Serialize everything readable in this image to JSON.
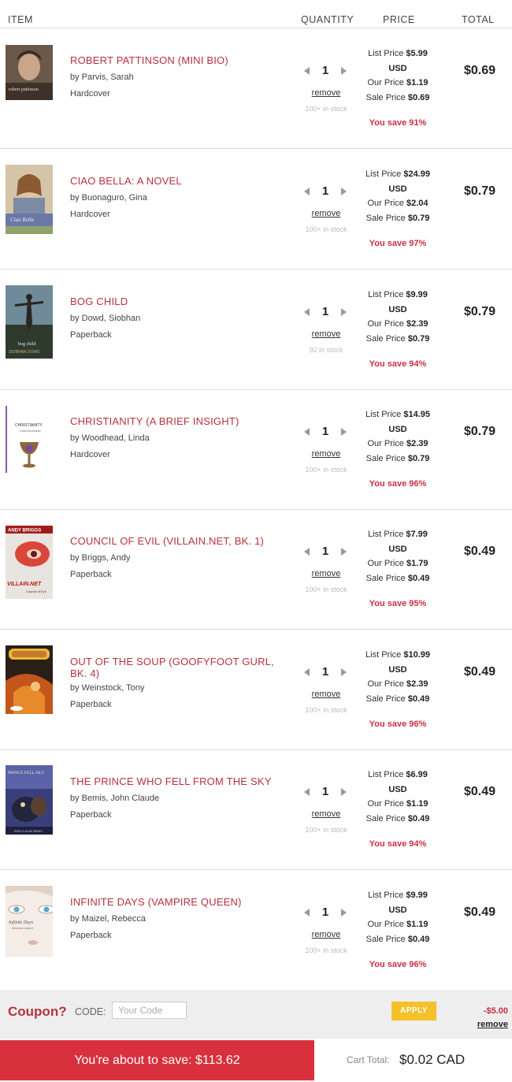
{
  "header": {
    "item": "ITEM",
    "quantity": "QUANTITY",
    "price": "PRICE",
    "total": "TOTAL"
  },
  "items": [
    {
      "title": "ROBERT PATTINSON (MINI BIO)",
      "author": "by Parvis, Sarah",
      "format": "Hardcover",
      "quantity": "1",
      "remove": "remove",
      "stock": "100+ in stock",
      "list_price": "$5.99",
      "currency": "USD",
      "our_price": "$1.19",
      "sale_price": "$0.69",
      "you_save": "You save 91%",
      "total": "$0.69"
    },
    {
      "title": "CIAO BELLA: A NOVEL",
      "author": "by Buonaguro, Gina",
      "format": "Hardcover",
      "quantity": "1",
      "remove": "remove",
      "stock": "100+ in stock",
      "list_price": "$24.99",
      "currency": "USD",
      "our_price": "$2.04",
      "sale_price": "$0.79",
      "you_save": "You save 97%",
      "total": "$0.79"
    },
    {
      "title": "BOG CHILD",
      "author": "by Dowd, Siobhan",
      "format": "Paperback",
      "quantity": "1",
      "remove": "remove",
      "stock": "92 in stock",
      "list_price": "$9.99",
      "currency": "USD",
      "our_price": "$2.39",
      "sale_price": "$0.79",
      "you_save": "You save 94%",
      "total": "$0.79"
    },
    {
      "title": "CHRISTIANITY (A BRIEF INSIGHT)",
      "author": "by Woodhead, Linda",
      "format": "Hardcover",
      "quantity": "1",
      "remove": "remove",
      "stock": "100+ in stock",
      "list_price": "$14.95",
      "currency": "USD",
      "our_price": "$2.39",
      "sale_price": "$0.79",
      "you_save": "You save 96%",
      "total": "$0.79"
    },
    {
      "title": "COUNCIL OF EVIL (VILLAIN.NET, BK. 1)",
      "author": "by Briggs, Andy",
      "format": "Paperback",
      "quantity": "1",
      "remove": "remove",
      "stock": "100+ in stock",
      "list_price": "$7.99",
      "currency": "USD",
      "our_price": "$1.79",
      "sale_price": "$0.49",
      "you_save": "You save 95%",
      "total": "$0.49"
    },
    {
      "title": "OUT OF THE SOUP (GOOFYFOOT GURL, BK. 4)",
      "author": "by Weinstock, Tony",
      "format": "Paperback",
      "quantity": "1",
      "remove": "remove",
      "stock": "100+ in stock",
      "list_price": "$10.99",
      "currency": "USD",
      "our_price": "$2.39",
      "sale_price": "$0.49",
      "you_save": "You save 96%",
      "total": "$0.49"
    },
    {
      "title": "THE PRINCE WHO FELL FROM THE SKY",
      "author": "by Bemis, John Claude",
      "format": "Paperback",
      "quantity": "1",
      "remove": "remove",
      "stock": "100+ in stock",
      "list_price": "$6.99",
      "currency": "USD",
      "our_price": "$1.19",
      "sale_price": "$0.49",
      "you_save": "You save 94%",
      "total": "$0.49"
    },
    {
      "title": "INFINITE DAYS (VAMPIRE QUEEN)",
      "author": "by Maizel, Rebecca",
      "format": "Paperback",
      "quantity": "1",
      "remove": "remove",
      "stock": "100+ in stock",
      "list_price": "$9.99",
      "currency": "USD",
      "our_price": "$1.19",
      "sale_price": "$0.49",
      "you_save": "You save 96%",
      "total": "$0.49"
    }
  ],
  "price_labels": {
    "list": "List Price",
    "our": "Our Price",
    "sale": "Sale Price"
  },
  "cover_text": {
    "c0": "robert pattinson",
    "c1": "Ciao Bella",
    "c2": "bog child",
    "c2b": "SIOBHAN DOWD",
    "c3": "CHRISTIANITY",
    "c3b": "Linda Woodhead",
    "c4": "ANDY BRIGGS",
    "c4b": "VILLAIN.NET",
    "c4c": "Council of Evil",
    "c6": "PRINCE FELL SKY",
    "c6b": "JOHN CLAUDE BEMIS",
    "c7": "Infinite Days",
    "c7b": "rebecca maizel"
  },
  "coupon": {
    "title": "Coupon?",
    "code_label": "CODE:",
    "placeholder": "Your Code",
    "apply": "APPLY",
    "discount": "-$5.00",
    "remove": "remove"
  },
  "footer": {
    "save_text": "You're about to save: $113.62",
    "cart_total_label": "Cart Total:",
    "cart_total_value": "$0.02 CAD"
  },
  "colors": {
    "accent": "#b8323f",
    "banner": "#d9303d",
    "apply": "#f4c12b"
  }
}
